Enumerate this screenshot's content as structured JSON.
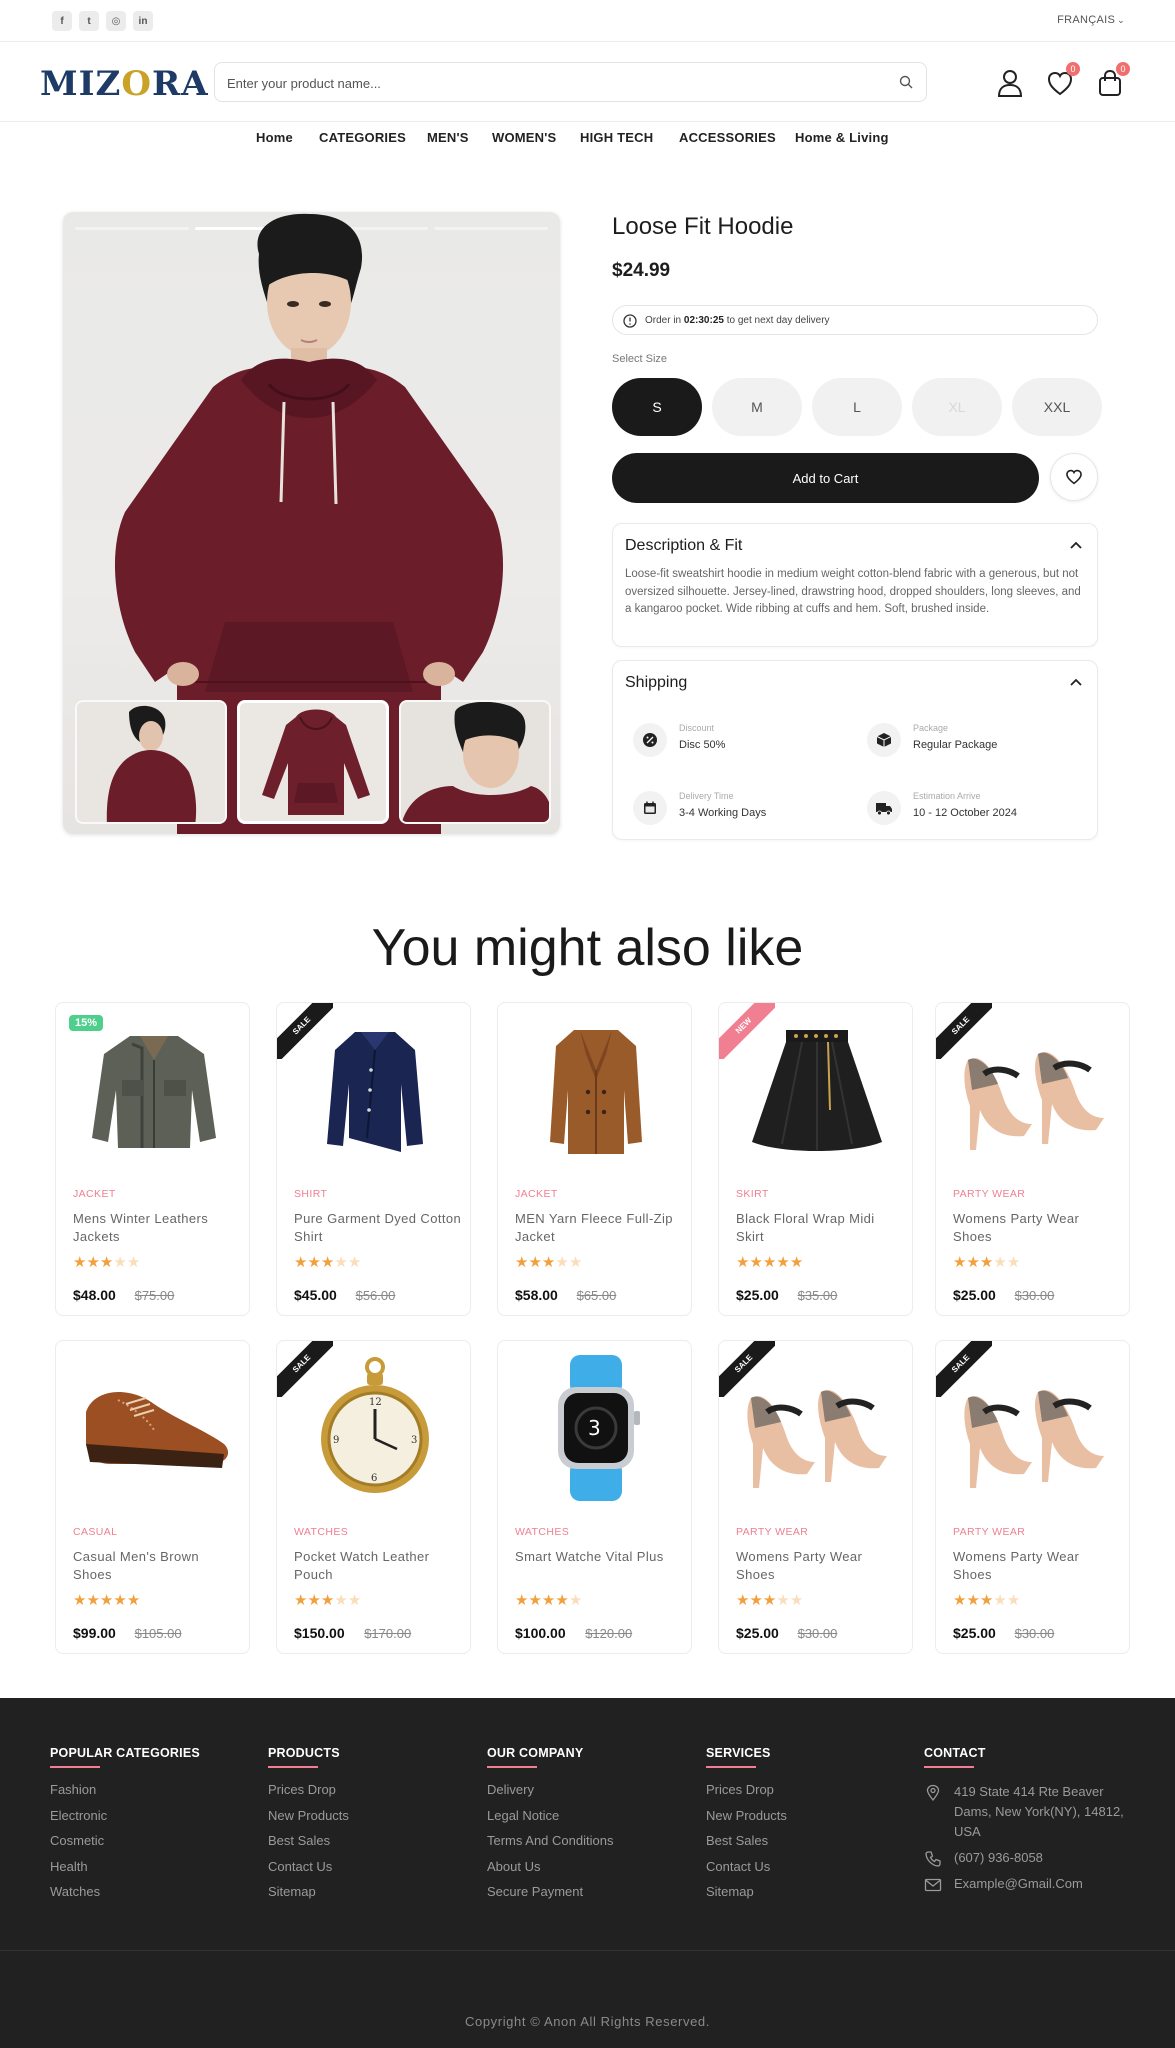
{
  "topbar": {
    "socials": [
      {
        "icon": "facebook-icon",
        "glyph": "f"
      },
      {
        "icon": "twitter-icon",
        "glyph": "t"
      },
      {
        "icon": "instagram-icon",
        "glyph": "◎"
      },
      {
        "icon": "linkedin-icon",
        "glyph": "in"
      }
    ],
    "language": "FRANÇAIS"
  },
  "header": {
    "logo_text_a": "MIZ",
    "logo_text_o": "O",
    "logo_text_b": "RA",
    "search_placeholder": "Enter your product name...",
    "wishlist_count": "0",
    "cart_count": "0"
  },
  "nav": [
    "Home",
    "CATEGORIES",
    "MEN'S",
    "WOMEN'S",
    "HIGH TECH",
    "ACCESSORIES",
    "Home & Living"
  ],
  "product": {
    "title": "Loose Fit Hoodie",
    "price": "$24.99",
    "timer_prefix": "Order in ",
    "timer_value": "02:30:25",
    "timer_suffix": " to get next day delivery",
    "size_label": "Select Size",
    "sizes": [
      {
        "label": "S",
        "state": "selected"
      },
      {
        "label": "M",
        "state": "available"
      },
      {
        "label": "L",
        "state": "available"
      },
      {
        "label": "XL",
        "state": "disabled"
      },
      {
        "label": "XXL",
        "state": "available"
      }
    ],
    "add_to_cart": "Add to Cart",
    "description_title": "Description & Fit",
    "description": "Loose-fit sweatshirt hoodie in medium weight cotton-blend fabric with a generous, but not oversized silhouette. Jersey-lined, drawstring hood, dropped shoulders, long sleeves, and a kangaroo pocket. Wide ribbing at cuffs and hem. Soft, brushed inside.",
    "shipping_title": "Shipping",
    "shipping": [
      {
        "label": "Discount",
        "value": "Disc 50%",
        "icon": "discount-icon"
      },
      {
        "label": "Package",
        "value": "Regular Package",
        "icon": "package-icon"
      },
      {
        "label": "Delivery Time",
        "value": "3-4 Working Days",
        "icon": "calendar-icon"
      },
      {
        "label": "Estimation Arrive",
        "value": "10 - 12 October 2024",
        "icon": "truck-icon"
      }
    ]
  },
  "related": {
    "title": "You might also like",
    "items": [
      {
        "category": "JACKET",
        "name": "Mens Winter Leathers Jackets",
        "rating": 3,
        "price": "$48.00",
        "old_price": "$75.00",
        "tag": "15%",
        "tag_type": "percent",
        "img": "jacket"
      },
      {
        "category": "SHIRT",
        "name": "Pure Garment Dyed Cotton Shirt",
        "rating": 3,
        "price": "$45.00",
        "old_price": "$56.00",
        "tag": "SALE",
        "tag_type": "sale",
        "img": "shirt"
      },
      {
        "category": "JACKET",
        "name": "MEN Yarn Fleece Full-Zip Jacket",
        "rating": 3,
        "price": "$58.00",
        "old_price": "$65.00",
        "tag": "",
        "tag_type": "none",
        "img": "coat"
      },
      {
        "category": "SKIRT",
        "name": "Black Floral Wrap Midi Skirt",
        "rating": 5,
        "price": "$25.00",
        "old_price": "$35.00",
        "tag": "NEW",
        "tag_type": "new",
        "img": "skirt"
      },
      {
        "category": "PARTY WEAR",
        "name": "Womens Party Wear Shoes",
        "rating": 3,
        "price": "$25.00",
        "old_price": "$30.00",
        "tag": "SALE",
        "tag_type": "sale",
        "img": "heels"
      },
      {
        "category": "CASUAL",
        "name": "Casual Men's Brown Shoes",
        "rating": 5,
        "price": "$99.00",
        "old_price": "$105.00",
        "tag": "",
        "tag_type": "none",
        "img": "brogue"
      },
      {
        "category": "WATCHES",
        "name": "Pocket Watch Leather Pouch",
        "rating": 3,
        "price": "$150.00",
        "old_price": "$170.00",
        "tag": "SALE",
        "tag_type": "sale",
        "img": "pocketwatch"
      },
      {
        "category": "WATCHES",
        "name": "Smart Watche Vital Plus",
        "rating": 4,
        "price": "$100.00",
        "old_price": "$120.00",
        "tag": "",
        "tag_type": "none",
        "img": "smartwatch"
      },
      {
        "category": "PARTY WEAR",
        "name": "Womens Party Wear Shoes",
        "rating": 3,
        "price": "$25.00",
        "old_price": "$30.00",
        "tag": "SALE",
        "tag_type": "sale",
        "img": "heels"
      },
      {
        "category": "PARTY WEAR",
        "name": "Womens Party Wear Shoes",
        "rating": 3,
        "price": "$25.00",
        "old_price": "$30.00",
        "tag": "SALE",
        "tag_type": "sale",
        "img": "heels"
      }
    ]
  },
  "footer": {
    "columns": [
      {
        "title": "POPULAR CATEGORIES",
        "links": [
          "Fashion",
          "Electronic",
          "Cosmetic",
          "Health",
          "Watches"
        ]
      },
      {
        "title": "PRODUCTS",
        "links": [
          "Prices Drop",
          "New Products",
          "Best Sales",
          "Contact Us",
          "Sitemap"
        ]
      },
      {
        "title": "OUR COMPANY",
        "links": [
          "Delivery",
          "Legal Notice",
          "Terms And Conditions",
          "About Us",
          "Secure Payment"
        ]
      },
      {
        "title": "SERVICES",
        "links": [
          "Prices Drop",
          "New Products",
          "Best Sales",
          "Contact Us",
          "Sitemap"
        ]
      }
    ],
    "contact_title": "CONTACT",
    "address": "419 State 414 Rte Beaver Dams, New York(NY), 14812, USA",
    "phone": "(607) 936-8058",
    "email": "Example@Gmail.Com",
    "copyright": "Copyright © Anon All Rights Reserved."
  },
  "colors": {
    "accent": "#ef7f91",
    "star": "#f2a03d",
    "dark": "#1a1a1a",
    "footer_bg": "#212121",
    "percent_badge": "#4ecf8c",
    "hoodie": "#6b1d2a"
  }
}
